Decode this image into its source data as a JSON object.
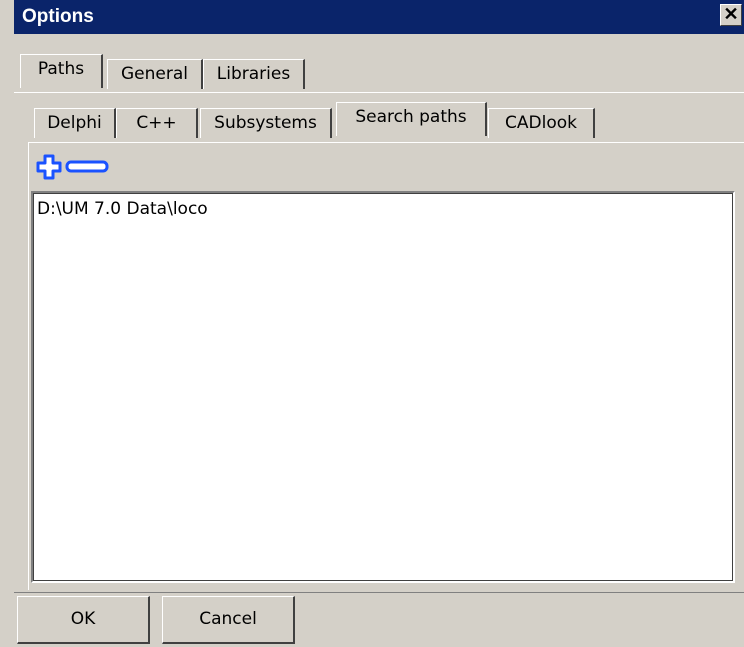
{
  "window": {
    "title": "Options",
    "close_glyph": "✕"
  },
  "top_tabs": [
    {
      "label": "Paths",
      "active": true
    },
    {
      "label": "General",
      "active": false
    },
    {
      "label": "Libraries",
      "active": false
    }
  ],
  "sub_tabs": [
    {
      "label": "Delphi",
      "active": false
    },
    {
      "label": "C++",
      "active": false
    },
    {
      "label": "Subsystems",
      "active": false
    },
    {
      "label": "Search paths",
      "active": true
    },
    {
      "label": "CADlook",
      "active": false
    }
  ],
  "toolbar": {
    "add_icon": "plus-icon",
    "remove_icon": "minus-icon",
    "icon_color": "#1a52ff"
  },
  "paths_list": {
    "items": [
      "D:\\UM 7.0 Data\\loco"
    ]
  },
  "buttons": {
    "ok_label": "OK",
    "cancel_label": "Cancel"
  }
}
